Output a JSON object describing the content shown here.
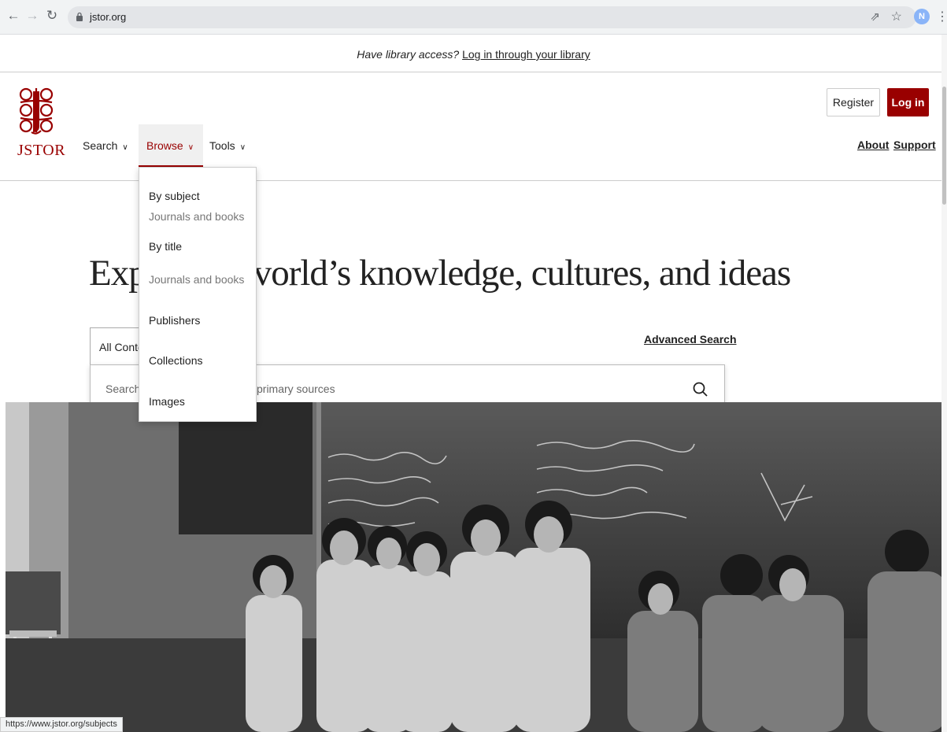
{
  "browser": {
    "url": "jstor.org",
    "profile_initial": "N",
    "status_url": "https://www.jstor.org/subjects"
  },
  "banner": {
    "lead": "Have library access?",
    "link": "Log in through your library"
  },
  "header": {
    "logo_text": "JSTOR",
    "nav": [
      {
        "label": "Search"
      },
      {
        "label": "Browse"
      },
      {
        "label": "Tools"
      }
    ],
    "register": "Register",
    "login": "Log in",
    "about": "About",
    "support": "Support"
  },
  "browse_menu": {
    "items": [
      {
        "label": "By subject",
        "sub": "Journals and books"
      },
      {
        "label": "By title",
        "sub": "Journals and books"
      },
      {
        "label": "Publishers"
      },
      {
        "label": "Collections"
      },
      {
        "label": "Images"
      }
    ]
  },
  "hero": {
    "title_start": "Exp",
    "title_end": "vorld’s knowledge, cultures, and ideas",
    "advanced_search": "Advanced Search",
    "content_select": "All Conte",
    "search_placeholder_start": "Search j",
    "search_placeholder_end": "primary sources"
  },
  "colors": {
    "brand": "#990000",
    "border": "#cccccc"
  },
  "icons": [
    "back-icon",
    "forward-icon",
    "reload-icon",
    "lock-icon",
    "share-icon",
    "star-icon",
    "chevron-down-icon",
    "search-icon",
    "jstor-logo-icon",
    "kebab-menu-icon"
  ]
}
